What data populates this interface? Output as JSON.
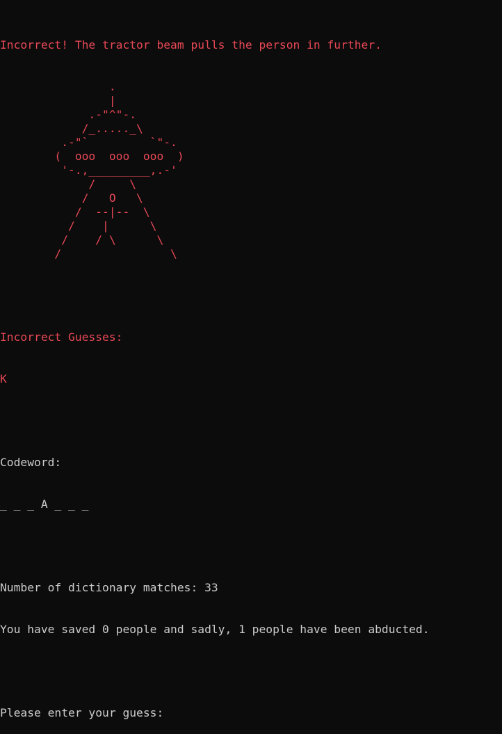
{
  "message": "Incorrect! The tractor beam pulls the person in further.",
  "ufo_art": [
    "                .",
    "                |",
    "             .-\"^\"-.",
    "            /_....._\\",
    "         .-\"`         `\"-.",
    "        (  ooo  ooo  ooo  )",
    "         '-.,_________,.-'",
    "             /     \\",
    "            /   O   \\",
    "           /  --|--  \\",
    "          /    |      \\",
    "         /    / \\      \\",
    "        /                \\"
  ],
  "incorrect_guesses": {
    "label": "Incorrect Guesses:",
    "letters": "K"
  },
  "codeword": {
    "label": "Codeword:",
    "value": "_ _ _ A _ _ _"
  },
  "matches_line": "Number of dictionary matches: 33",
  "status_line": "You have saved 0 people and sadly, 1 people have been abducted.",
  "prompt": "Please enter your guess: ",
  "colors": {
    "background": "#0c0c0c",
    "error_red": "#e74856",
    "text_gray": "#cccccc"
  }
}
